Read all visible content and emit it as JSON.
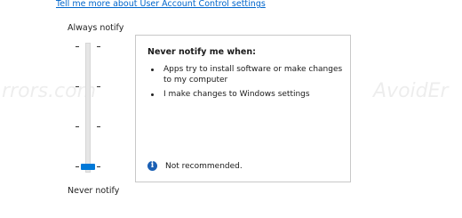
{
  "help_link": "Tell me more about User Account Control settings",
  "slider": {
    "top_label": "Always notify",
    "bottom_label": "Never notify",
    "levels": 4,
    "selected_level": 1
  },
  "description": {
    "title": "Never notify me when:",
    "items": [
      "Apps try to install software or make changes to my computer",
      "I make changes to Windows settings"
    ],
    "note": "Not recommended."
  },
  "watermarks": [
    "rrors.com",
    "AvoidErrors.com",
    "AvoidEr"
  ],
  "colors": {
    "link": "#0066cc",
    "thumb": "#0078d7",
    "info_icon": "#1a5fb4"
  }
}
